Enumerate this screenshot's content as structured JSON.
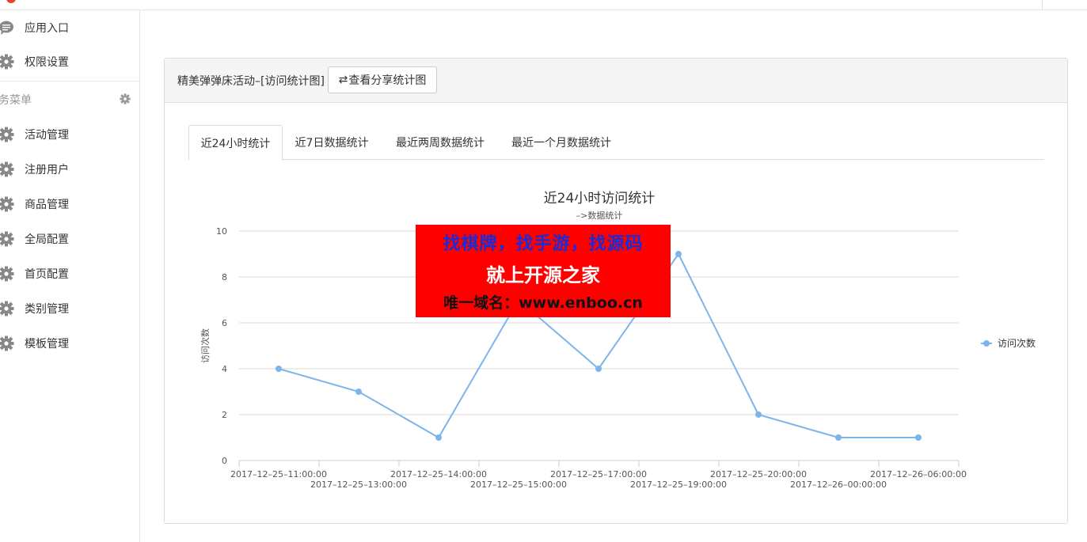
{
  "colors": {
    "accent": "#7cb5ec",
    "watermark_bg": "#ff0000",
    "watermark_line1": "#1a2bd8"
  },
  "sidebar": {
    "items_top": [
      {
        "label": "应用入口",
        "icon": "chat-icon"
      },
      {
        "label": "权限设置",
        "icon": "gear-icon"
      }
    ],
    "section_label": "务菜单",
    "section_icon": "gear-icon",
    "items": [
      {
        "label": "活动管理",
        "icon": "gear-icon"
      },
      {
        "label": "注册用户",
        "icon": "gear-icon"
      },
      {
        "label": "商品管理",
        "icon": "gear-icon"
      },
      {
        "label": "全局配置",
        "icon": "gear-icon"
      },
      {
        "label": "首页配置",
        "icon": "gear-icon"
      },
      {
        "label": "类别管理",
        "icon": "gear-icon"
      },
      {
        "label": "模板管理",
        "icon": "gear-icon"
      }
    ]
  },
  "panel": {
    "title": "精美弹弹床活动–[访问统计图]",
    "share_button_icon": "swap-icon",
    "share_button_label": "查看分享统计图"
  },
  "tabs": [
    {
      "label": "近24小时统计",
      "active": true
    },
    {
      "label": "近7日数据统计",
      "active": false
    },
    {
      "label": "最近两周数据统计",
      "active": false
    },
    {
      "label": "最近一个月数据统计",
      "active": false
    }
  ],
  "chart_data": {
    "type": "line",
    "title": "近24小时访问统计",
    "subtitle": "–>数据统计",
    "xlabel": "",
    "ylabel": "访问次数",
    "ylim": [
      0,
      10
    ],
    "yticks": [
      0,
      2,
      4,
      6,
      8,
      10
    ],
    "grid": true,
    "legend_position": "right",
    "categories": [
      "2017–12–25–11:00:00",
      "2017–12–25–13:00:00",
      "2017–12–25–14:00:00",
      "2017–12–25–15:00:00",
      "2017–12–25–17:00:00",
      "2017–12–25–19:00:00",
      "2017–12–25–20:00:00",
      "2017–12–26–00:00:00",
      "2017–12–26–06:00:00"
    ],
    "series": [
      {
        "name": "访问次数",
        "color": "#7cb5ec",
        "values": [
          4,
          3,
          1,
          7,
          4,
          9,
          2,
          1,
          1
        ]
      }
    ]
  },
  "watermark": {
    "line1": "找棋牌，找手游，找源码",
    "line2": "就上开源之家",
    "line3": "唯一域名：www.enboo.cn"
  }
}
